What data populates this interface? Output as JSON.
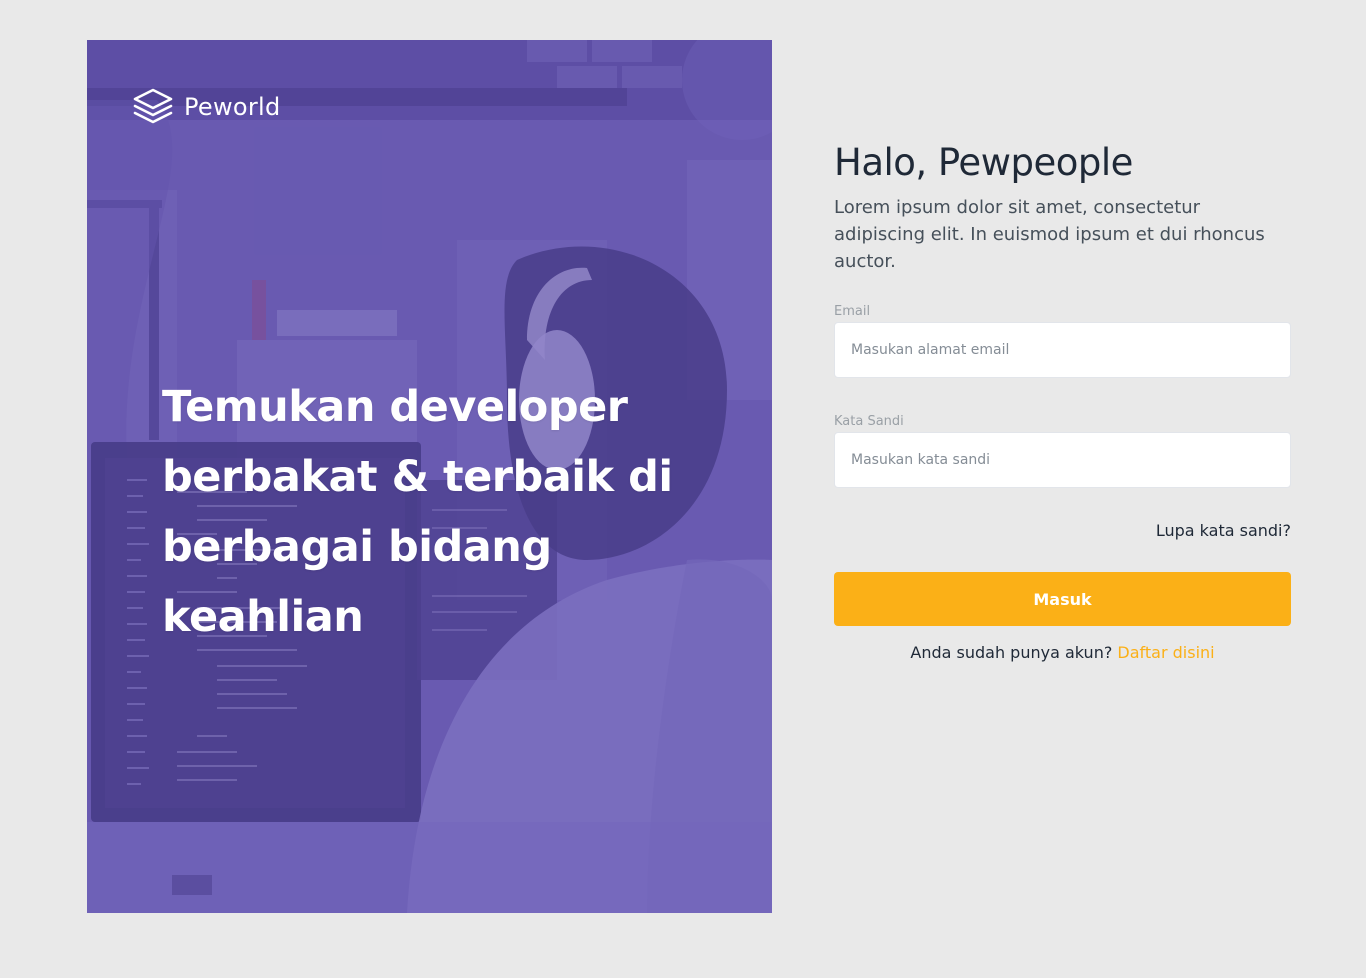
{
  "brand": {
    "name": "Peworld",
    "logo_icon": "layers-stack-icon"
  },
  "hero": {
    "headline_lines": [
      "Temukan developer",
      "berbakat & terbaik di",
      "berbagai bidang keahlian"
    ]
  },
  "form": {
    "title": "Halo, Pewpeople",
    "subtitle": "Lorem ipsum dolor sit amet, consectetur adipiscing elit. In euismod ipsum et dui rhoncus auctor.",
    "email": {
      "label": "Email",
      "placeholder": "Masukan alamat email",
      "value": ""
    },
    "password": {
      "label": "Kata Sandi",
      "placeholder": "Masukan kata sandi",
      "value": ""
    },
    "forgot_label": "Lupa kata sandi?",
    "submit_label": "Masuk",
    "register_prompt": "Anda sudah punya akun?",
    "register_link": "Daftar disini"
  },
  "colors": {
    "page_bg": "#e9e9e9",
    "hero_tint": "#5e50ab",
    "accent": "#fbb017",
    "heading_text": "#1f2937"
  }
}
